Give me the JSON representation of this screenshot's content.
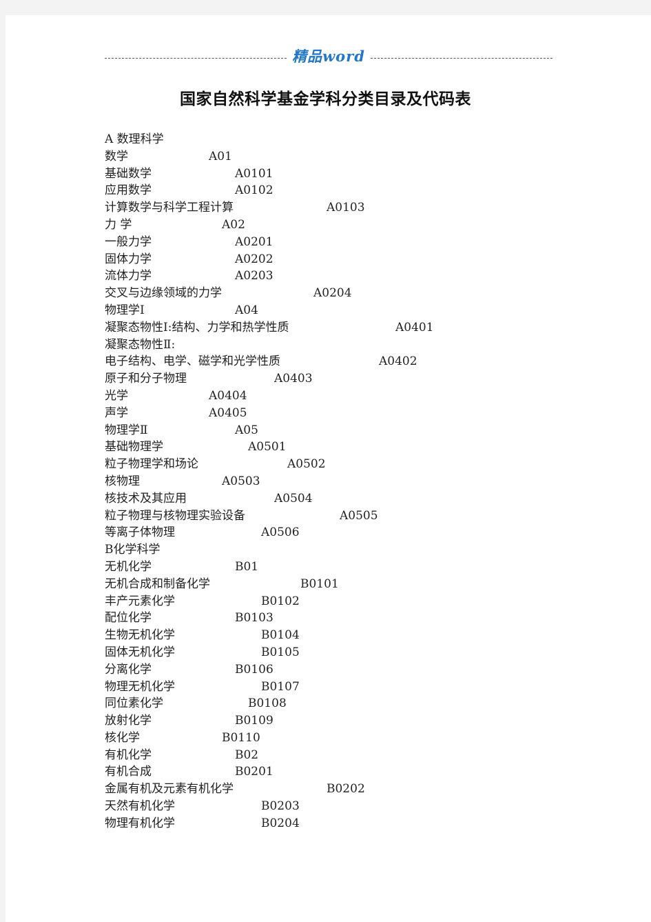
{
  "header": {
    "brand_label": "精品word"
  },
  "document": {
    "title": "国家自然科学基金学科分类目录及代码表",
    "entries": [
      {
        "name": "A 数理科学",
        "code": ""
      },
      {
        "name": "数学",
        "code": "A01",
        "col": 151
      },
      {
        "name": "基础数学",
        "code": "A0101",
        "col": 189
      },
      {
        "name": "应用数学",
        "code": "A0102",
        "col": 189
      },
      {
        "name": "计算数学与科学工程计算",
        "code": "A0103",
        "col": 322
      },
      {
        "name": "力 学",
        "code": "A02",
        "col": 170
      },
      {
        "name": "一般力学",
        "code": "A0201",
        "col": 189
      },
      {
        "name": "固体力学",
        "code": "A0202",
        "col": 189
      },
      {
        "name": "流体力学",
        "code": "A0203",
        "col": 189
      },
      {
        "name": "交叉与边缘领域的力学",
        "code": "A0204",
        "col": 303
      },
      {
        "name": "物理学Ⅰ",
        "code": "A04",
        "col": 189
      },
      {
        "name": "凝聚态物性Ⅰ:结构、力学和热学性质",
        "code": "A0401",
        "col": 422
      },
      {
        "name": "凝聚态物性Ⅱ:",
        "code": ""
      },
      {
        "name": "电子结构、电学、磁学和光学性质",
        "code": "A0402",
        "col": 398
      },
      {
        "name": "原子和分子物理",
        "code": "A0403",
        "col": 246
      },
      {
        "name": "光学",
        "code": "A0404",
        "col": 151
      },
      {
        "name": "声学",
        "code": "A0405",
        "col": 151
      },
      {
        "name": "物理学Ⅱ",
        "code": "A05",
        "col": 189
      },
      {
        "name": "基础物理学",
        "code": "A0501",
        "col": 208
      },
      {
        "name": "粒子物理学和场论",
        "code": "A0502",
        "col": 265
      },
      {
        "name": "核物理",
        "code": "A0503",
        "col": 170
      },
      {
        "name": "核技术及其应用",
        "code": "A0504",
        "col": 246
      },
      {
        "name": "粒子物理与核物理实验设备",
        "code": "A0505",
        "col": 341
      },
      {
        "name": "等离子体物理",
        "code": "A0506",
        "col": 227
      },
      {
        "name": "B化学科学",
        "code": ""
      },
      {
        "name": "无机化学",
        "code": "B01",
        "col": 189
      },
      {
        "name": "无机合成和制备化学",
        "code": "B0101",
        "col": 284
      },
      {
        "name": "丰产元素化学",
        "code": "B0102",
        "col": 227
      },
      {
        "name": "配位化学",
        "code": "B0103",
        "col": 189
      },
      {
        "name": "生物无机化学",
        "code": "B0104",
        "col": 227
      },
      {
        "name": "固体无机化学",
        "code": "B0105",
        "col": 227
      },
      {
        "name": "分离化学",
        "code": "B0106",
        "col": 189
      },
      {
        "name": "物理无机化学",
        "code": "B0107",
        "col": 227
      },
      {
        "name": "同位素化学",
        "code": "B0108",
        "col": 208
      },
      {
        "name": "放射化学",
        "code": "B0109",
        "col": 189
      },
      {
        "name": "核化学",
        "code": "B0110",
        "col": 170
      },
      {
        "name": "有机化学",
        "code": "B02",
        "col": 189
      },
      {
        "name": "有机合成",
        "code": "B0201",
        "col": 189
      },
      {
        "name": "金属有机及元素有机化学",
        "code": "B0202",
        "col": 322
      },
      {
        "name": "天然有机化学",
        "code": "B0203",
        "col": 227
      },
      {
        "name": "物理有机化学",
        "code": "B0204",
        "col": 227
      }
    ]
  }
}
